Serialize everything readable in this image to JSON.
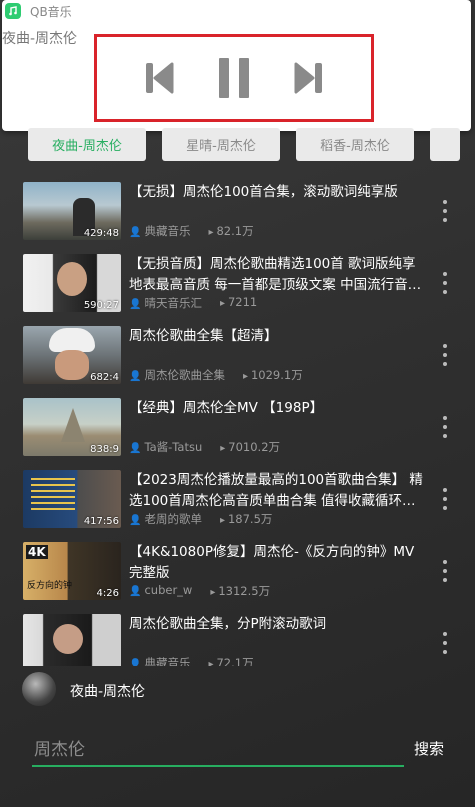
{
  "app": {
    "name": "QB音乐",
    "now_playing": "夜曲-周杰伦"
  },
  "colors": {
    "accent": "#27ae60",
    "highlight_box": "#d9232a"
  },
  "controls": {
    "prev": "previous-icon",
    "pause": "pause-icon",
    "next": "next-icon"
  },
  "tabs": [
    {
      "label": "夜曲-周杰伦",
      "active": true
    },
    {
      "label": "星晴-周杰伦",
      "active": false
    },
    {
      "label": "稻香-周杰伦",
      "active": false
    }
  ],
  "videos": [
    {
      "title": "【无损】周杰伦100首合集，滚动歌词纯享版",
      "duration": "429:48",
      "author": "典藏音乐",
      "plays": "82.1万"
    },
    {
      "title": "【无损音质】周杰伦歌曲精选100首 歌词版纯享地表最高音质 每一首都是顶级文案 中国流行音…",
      "duration": "590:27",
      "author": "晴天音乐汇",
      "plays": "7211"
    },
    {
      "title": "周杰伦歌曲全集【超清】",
      "duration": "682:4",
      "author": "周杰伦歌曲全集",
      "plays": "1029.1万"
    },
    {
      "title": "【经典】周杰伦全MV 【198P】",
      "duration": "838:9",
      "author": "Ta酱-Tatsu",
      "plays": "7010.2万"
    },
    {
      "title": "【2023周杰伦播放量最高的100首歌曲合集】 精选100首周杰伦高音质单曲合集 值得收藏循环…",
      "duration": "417:56",
      "author": "老周的歌单",
      "plays": "187.5万"
    },
    {
      "title": "【4K&1080P修复】周杰伦-《反方向的钟》MV完整版",
      "duration": "4:26",
      "author": "cuber_w",
      "plays": "1312.5万"
    },
    {
      "title": "周杰伦歌曲全集，分P附滚动歌词",
      "duration": "",
      "author": "典藏音乐",
      "plays": "72.1万"
    }
  ],
  "mini_player": {
    "label": "夜曲-周杰伦"
  },
  "search": {
    "value": "",
    "placeholder": "周杰伦",
    "button": "搜索"
  }
}
